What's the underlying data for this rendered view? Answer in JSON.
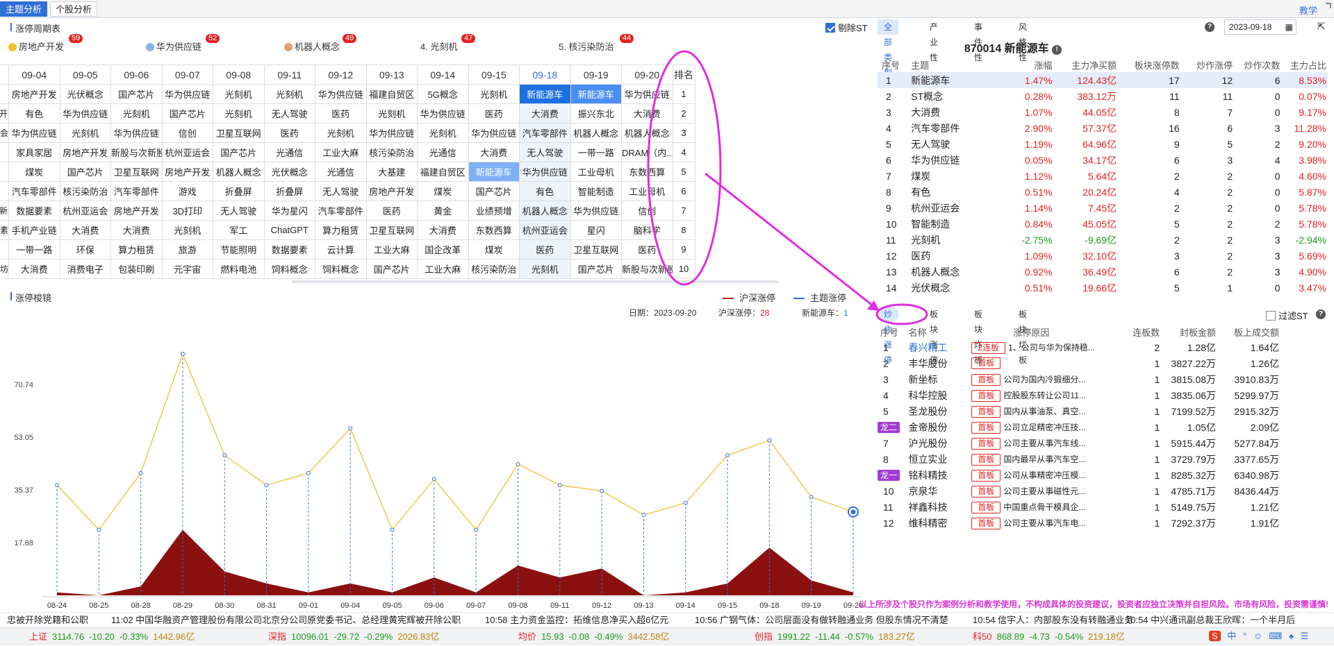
{
  "tabs": [
    "主题分析",
    "个股分析"
  ],
  "teach_link": "教学",
  "left_top": {
    "title": "涨停周期表",
    "exclude_st": "剔除ST",
    "themes": [
      {
        "name": "房地产开发",
        "count": "59",
        "icon": "gold-circle"
      },
      {
        "name": "华为供应链",
        "count": "52",
        "icon": "blue-circle"
      },
      {
        "name": "机器人概念",
        "count": "49",
        "icon": "bronze-circle"
      },
      {
        "name": "4. 光刻机",
        "count": "47"
      },
      {
        "name": "5. 核污染防治",
        "count": "44"
      }
    ],
    "grid": {
      "dates": [
        "09-04",
        "09-05",
        "09-06",
        "09-07",
        "09-08",
        "09-11",
        "09-12",
        "09-13",
        "09-14",
        "09-15",
        "09-18",
        "09-19",
        "09-20"
      ],
      "rank_header": "排名",
      "row_labels": [
        "",
        "开发",
        "会",
        "",
        "",
        "",
        "新股",
        "素",
        "",
        "坊"
      ],
      "ranks": [
        "1",
        "2",
        "3",
        "4",
        "5",
        "6",
        "7",
        "8",
        "9",
        "10"
      ],
      "rows": [
        [
          "房地产开发",
          "光伏概念",
          "国产芯片",
          "华为供应链",
          "光刻机",
          "光刻机",
          "华为供应链",
          "福建自贸区",
          "5G概念",
          "光刻机",
          "新能源车",
          "新能源车",
          "华为供应链"
        ],
        [
          "有色",
          "华为供应链",
          "光刻机",
          "国产芯片",
          "光刻机",
          "无人驾驶",
          "医药",
          "光刻机",
          "华为供应链",
          "医药",
          "大消费",
          "振兴东北",
          "大消费"
        ],
        [
          "华为供应链",
          "光刻机",
          "华为供应链",
          "信创",
          "卫星互联网",
          "医药",
          "光刻机",
          "华为供应链",
          "光刻机",
          "华为供应链",
          "汽车零部件",
          "机器人概念",
          "机器人概念"
        ],
        [
          "家具家居",
          "房地产开发",
          "新股与次新股",
          "杭州亚运会",
          "国产芯片",
          "光通信",
          "工业大麻",
          "核污染防治",
          "光通信",
          "大消费",
          "无人驾驶",
          "一带一路",
          "DRAM（内..."
        ],
        [
          "煤炭",
          "国产芯片",
          "卫星互联网",
          "房地产开发",
          "机器人概念",
          "光伏概念",
          "光通信",
          "大基建",
          "福建自贸区",
          "新能源车",
          "华为供应链",
          "工业母机",
          "东数西算"
        ],
        [
          "汽车零部件",
          "核污染防治",
          "汽车零部件",
          "游戏",
          "折叠屏",
          "折叠屏",
          "无人驾驶",
          "房地产开发",
          "煤炭",
          "国产芯片",
          "有色",
          "智能制造",
          "工业母机"
        ],
        [
          "数据要素",
          "杭州亚运会",
          "房地产开发",
          "3D打印",
          "无人驾驶",
          "华为星闪",
          "汽车零部件",
          "医药",
          "黄金",
          "业绩预增",
          "机器人概念",
          "华为供应链",
          "信创"
        ],
        [
          "手机产业链",
          "大消费",
          "大消费",
          "光刻机",
          "军工",
          "ChatGPT",
          "算力租赁",
          "卫星互联网",
          "大消费",
          "东数西算",
          "杭州亚运会",
          "星闪",
          "脑科学"
        ],
        [
          "一带一路",
          "环保",
          "算力租赁",
          "旅游",
          "节能照明",
          "数据要素",
          "云计算",
          "工业大麻",
          "国企改革",
          "煤炭",
          "医药",
          "卫星互联网",
          "医药"
        ],
        [
          "大消费",
          "消费电子",
          "包装印刷",
          "元宇宙",
          "燃料电池",
          "饲料概念",
          "饲料概念",
          "国产芯片",
          "工业大麻",
          "核污染防治",
          "光刻机",
          "国产芯片",
          "新股与次新股"
        ]
      ]
    }
  },
  "left_chart": {
    "title": "涨停梭镜",
    "legend": [
      {
        "name": "沪深涨停",
        "color": "#b01818"
      },
      {
        "name": "主题涨停",
        "color": "#2f6fd6"
      }
    ],
    "info": {
      "date_label": "日期：",
      "date": "2023-09-20",
      "hs_label": "沪深涨停：",
      "hs_value": "28",
      "theme_label": "新能源车：",
      "theme_value": "1"
    }
  },
  "chart_data": {
    "type": "area",
    "title": "",
    "x": [
      "08-24",
      "08-25",
      "08-28",
      "08-29",
      "08-30",
      "08-31",
      "09-01",
      "09-04",
      "09-05",
      "09-06",
      "09-07",
      "09-08",
      "09-11",
      "09-12",
      "09-13",
      "09-14",
      "09-15",
      "09-18",
      "09-19",
      "09-20"
    ],
    "yticks": [
      "17.68",
      "35.37",
      "53.05",
      "70.74"
    ],
    "ylim": [
      0,
      88
    ],
    "series": [
      {
        "name": "沪深涨停",
        "values": [
          37,
          22,
          41,
          81,
          47,
          37,
          41,
          56,
          22,
          39,
          22,
          44,
          37,
          35,
          27,
          31,
          47,
          52,
          33,
          28
        ]
      },
      {
        "name": "新能源车",
        "values": [
          1,
          0,
          3,
          22,
          8,
          4,
          1,
          4,
          1,
          6,
          1,
          10,
          6,
          9,
          0,
          1,
          4,
          16,
          5,
          1
        ]
      }
    ],
    "colors": {
      "line": "#f2c12e",
      "area": "#8b1010",
      "drop": "#2f6fd6"
    }
  },
  "right_top": {
    "tabs": [
      "全部类型",
      "产业性",
      "事件性",
      "风格性"
    ],
    "date": "2023-09-18",
    "title": "870014 新能源车",
    "headers": [
      "序号",
      "主题",
      "涨幅",
      "主力净买额",
      "板块涨停数",
      "炒作涨停",
      "炒作次数",
      "主力占比"
    ],
    "rows": [
      [
        "1",
        "新能源车",
        "1.47%",
        "124.43亿",
        "17",
        "12",
        "6",
        "8.53%"
      ],
      [
        "2",
        "ST概念",
        "0.28%",
        "383.12万",
        "11",
        "11",
        "0",
        "0.07%"
      ],
      [
        "3",
        "大消费",
        "1.07%",
        "44.05亿",
        "8",
        "7",
        "0",
        "9.17%"
      ],
      [
        "4",
        "汽车零部件",
        "2.90%",
        "57.37亿",
        "16",
        "6",
        "3",
        "11.28%"
      ],
      [
        "5",
        "无人驾驶",
        "1.19%",
        "64.96亿",
        "9",
        "5",
        "2",
        "9.20%"
      ],
      [
        "6",
        "华为供应链",
        "0.05%",
        "34.17亿",
        "6",
        "3",
        "4",
        "3.98%"
      ],
      [
        "7",
        "煤炭",
        "1.12%",
        "5.64亿",
        "2",
        "2",
        "0",
        "4.60%"
      ],
      [
        "8",
        "有色",
        "0.51%",
        "20.24亿",
        "4",
        "2",
        "0",
        "5.87%"
      ],
      [
        "9",
        "杭州亚运会",
        "1.14%",
        "7.45亿",
        "2",
        "2",
        "0",
        "5.78%"
      ],
      [
        "10",
        "智能制造",
        "0.84%",
        "45.05亿",
        "5",
        "2",
        "2",
        "5.78%"
      ],
      [
        "11",
        "光刻机",
        "-2.75%",
        "-9.69亿",
        "2",
        "2",
        "3",
        "-2.94%"
      ],
      [
        "12",
        "医药",
        "1.09%",
        "32.10亿",
        "3",
        "2",
        "3",
        "5.69%"
      ],
      [
        "13",
        "机器人概念",
        "0.92%",
        "36.49亿",
        "6",
        "2",
        "3",
        "4.90%"
      ],
      [
        "14",
        "光伏概念",
        "0.51%",
        "19.66亿",
        "5",
        "1",
        "0",
        "3.47%"
      ]
    ]
  },
  "right_bottom": {
    "tabs": [
      "炒作涨停",
      "板块涨停",
      "板块炸板",
      "板块烂板"
    ],
    "filter_st": "过滤ST",
    "headers": [
      "序号",
      "名称",
      "涨停原因",
      "连板数",
      "封板金额",
      "板上成交额"
    ],
    "rows": [
      [
        "1",
        "春兴精工",
        "2连板",
        "1、公司与华为保持稳...",
        "2",
        "1.28亿",
        "1.64亿"
      ],
      [
        "2",
        "丰华股份",
        "首板",
        "",
        "1",
        "3827.22万",
        "1.26亿"
      ],
      [
        "3",
        "新坐标",
        "首板",
        "公司为国内冷锻细分...",
        "1",
        "3815.08万",
        "3910.83万"
      ],
      [
        "4",
        "科华控股",
        "首板",
        "控股股东转让公司11...",
        "1",
        "3835.06万",
        "5299.97万"
      ],
      [
        "5",
        "圣龙股份",
        "首板",
        "国内从事油泵、真空...",
        "1",
        "7199.52万",
        "2915.32万"
      ],
      [
        "龙二",
        "金帝股份",
        "首板",
        "公司立足精密冲压技...",
        "1",
        "1.05亿",
        "2.09亿"
      ],
      [
        "7",
        "沪光股份",
        "首板",
        "公司主要从事汽车线...",
        "1",
        "5915.44万",
        "5277.84万"
      ],
      [
        "8",
        "恒立实业",
        "首板",
        "国内最早从事汽车空...",
        "1",
        "3729.79万",
        "3377.65万"
      ],
      [
        "龙一",
        "铭科精技",
        "首板",
        "公司从事精密冲压模...",
        "1",
        "8285.32万",
        "6340.98万"
      ],
      [
        "10",
        "京泉华",
        "首板",
        "公司主要从事磁性元...",
        "1",
        "4785.71万",
        "8436.44万"
      ],
      [
        "11",
        "祥鑫科技",
        "首板",
        "中国重点骨干模具企...",
        "1",
        "5149.75万",
        "1.21亿"
      ],
      [
        "12",
        "维科精密",
        "首板",
        "公司主要从事汽车电...",
        "1",
        "7292.37万",
        "1.91亿"
      ]
    ]
  },
  "disclaimer": "以上所涉及个股只作为案例分析和教学使用，不构成具体的投资建议，投资者应独立决策并自担风险。市场有风险，投资需谨慎!",
  "ticker": [
    "忠被开除党籍和公职",
    "11:02 中国华融资产管理股份有限公司北京分公司原党委书记、总经理黄宪辉被开除公职",
    "10:58 主力资金监控：拓维信息净买入超6亿元",
    "10:56 广钢气体：公司层面没有做转融通业务 但股东情况不清楚",
    "10:54 信宇人：内部股东没有转融通业务",
    "10:54 中兴通讯副总裁王欣晖：一个半月后"
  ],
  "status": [
    {
      "name": "上证",
      "vals": [
        "3114.76",
        "-10.20",
        "-0.33%",
        "1442.96亿"
      ]
    },
    {
      "name": "深指",
      "vals": [
        "10096.01",
        "-29.72",
        "-0.29%",
        "2026.83亿"
      ]
    },
    {
      "name": "均价",
      "vals": [
        "15.93",
        "-0.08",
        "-0.49%",
        "3442.58亿"
      ]
    },
    {
      "name": "创指",
      "vals": [
        "1991.22",
        "-11.44",
        "-0.57%",
        "183.27亿"
      ]
    },
    {
      "name": "科50",
      "vals": [
        "868.89",
        "-4.73",
        "-0.54%",
        "219.18亿"
      ]
    }
  ],
  "tray_glyphs": [
    "中",
    "°",
    "☺"
  ]
}
